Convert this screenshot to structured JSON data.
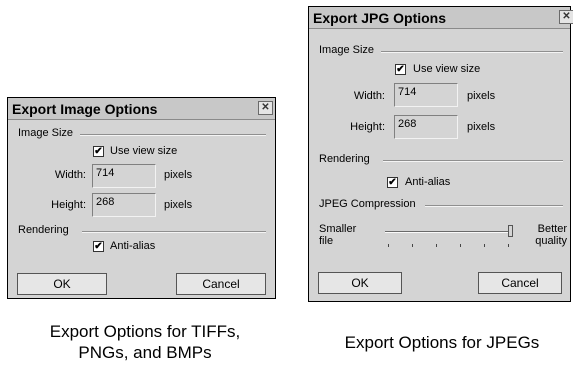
{
  "left_dialog": {
    "title": "Export Image Options",
    "close_glyph": "✕",
    "image_size_label": "Image Size",
    "use_view_size": {
      "label": "Use view size",
      "checked": true
    },
    "width": {
      "label": "Width:",
      "value": "714",
      "unit": "pixels"
    },
    "height": {
      "label": "Height:",
      "value": "268",
      "unit": "pixels"
    },
    "rendering_label": "Rendering",
    "anti_alias": {
      "label": "Anti-alias",
      "checked": true
    },
    "ok_label": "OK",
    "cancel_label": "Cancel"
  },
  "right_dialog": {
    "title": "Export JPG Options",
    "close_glyph": "✕",
    "image_size_label": "Image Size",
    "use_view_size": {
      "label": "Use view size",
      "checked": true
    },
    "width": {
      "label": "Width:",
      "value": "714",
      "unit": "pixels"
    },
    "height": {
      "label": "Height:",
      "value": "268",
      "unit": "pixels"
    },
    "rendering_label": "Rendering",
    "anti_alias": {
      "label": "Anti-alias",
      "checked": true
    },
    "jpeg_compression_label": "JPEG Compression",
    "slider_left_label": "Smaller file",
    "slider_right_label": "Better quality",
    "ok_label": "OK",
    "cancel_label": "Cancel"
  },
  "captions": {
    "left": "Export Options for TIFFs, PNGs, and BMPs",
    "right": "Export Options for JPEGs"
  },
  "icons": {
    "checkmark": "✔"
  }
}
